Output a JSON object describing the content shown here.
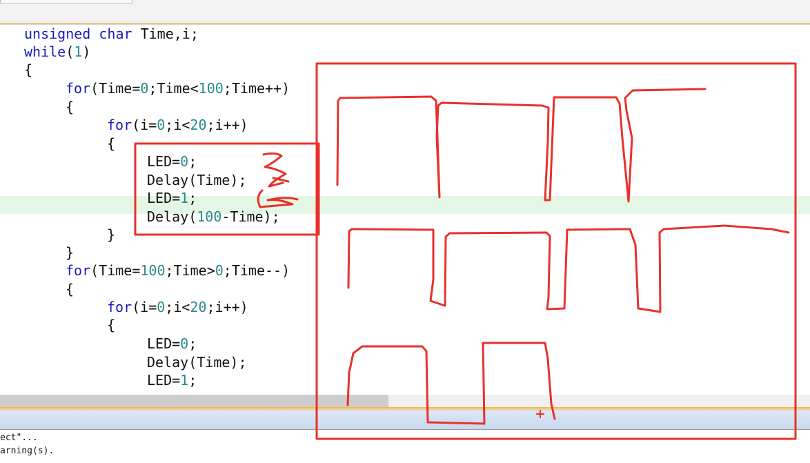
{
  "code": {
    "lines": [
      {
        "parts": [
          {
            "t": "unsigned char",
            "c": "kw"
          },
          {
            "t": " Time,i;"
          }
        ]
      },
      {
        "parts": [
          {
            "t": "while",
            "c": "kw"
          },
          {
            "t": "("
          },
          {
            "t": "1",
            "c": "num"
          },
          {
            "t": ")"
          }
        ]
      },
      {
        "parts": [
          {
            "t": "{"
          }
        ]
      },
      {
        "parts": [
          {
            "t": "for",
            "c": "kw"
          },
          {
            "t": "(Time="
          },
          {
            "t": "0",
            "c": "num"
          },
          {
            "t": ";Time<"
          },
          {
            "t": "100",
            "c": "num"
          },
          {
            "t": ";Time++)"
          }
        ]
      },
      {
        "parts": [
          {
            "t": "{"
          }
        ]
      },
      {
        "parts": [
          {
            "t": "for",
            "c": "kw"
          },
          {
            "t": "(i="
          },
          {
            "t": "0",
            "c": "num"
          },
          {
            "t": ";i<"
          },
          {
            "t": "20",
            "c": "num"
          },
          {
            "t": ";i++)"
          }
        ]
      },
      {
        "parts": [
          {
            "t": "{"
          }
        ]
      },
      {
        "parts": [
          {
            "t": "LED="
          },
          {
            "t": "0",
            "c": "num"
          },
          {
            "t": ";"
          }
        ]
      },
      {
        "parts": [
          {
            "t": "Delay(Time);"
          }
        ]
      },
      {
        "parts": [
          {
            "t": "LED="
          },
          {
            "t": "1",
            "c": "num"
          },
          {
            "t": ";"
          }
        ]
      },
      {
        "parts": [
          {
            "t": "Delay("
          },
          {
            "t": "100",
            "c": "num"
          },
          {
            "t": "-Time);"
          }
        ]
      },
      {
        "parts": [
          {
            "t": "}"
          }
        ]
      },
      {
        "parts": [
          {
            "t": "}"
          }
        ]
      },
      {
        "parts": [
          {
            "t": "for",
            "c": "kw"
          },
          {
            "t": "(Time="
          },
          {
            "t": "100",
            "c": "num"
          },
          {
            "t": ";Time>"
          },
          {
            "t": "0",
            "c": "num"
          },
          {
            "t": ";Time--)"
          }
        ]
      },
      {
        "parts": [
          {
            "t": "{"
          }
        ]
      },
      {
        "parts": [
          {
            "t": "for",
            "c": "kw"
          },
          {
            "t": "(i="
          },
          {
            "t": "0",
            "c": "num"
          },
          {
            "t": ";i<"
          },
          {
            "t": "20",
            "c": "num"
          },
          {
            "t": ";i++)"
          }
        ]
      },
      {
        "parts": [
          {
            "t": "{"
          }
        ]
      },
      {
        "parts": [
          {
            "t": "LED="
          },
          {
            "t": "0",
            "c": "num"
          },
          {
            "t": ";"
          }
        ]
      },
      {
        "parts": [
          {
            "t": "Delay(Time);"
          }
        ]
      },
      {
        "parts": [
          {
            "t": "LED="
          },
          {
            "t": "1",
            "c": "num"
          },
          {
            "t": ";"
          }
        ]
      }
    ]
  },
  "output": {
    "lines": [
      "ect\"...",
      "arning(s)."
    ]
  },
  "colors": {
    "keyword": "#1b1bbd",
    "number": "#2a8a8a",
    "current_line_highlight": "#e4f7e4",
    "annotation": "#e8312a"
  }
}
